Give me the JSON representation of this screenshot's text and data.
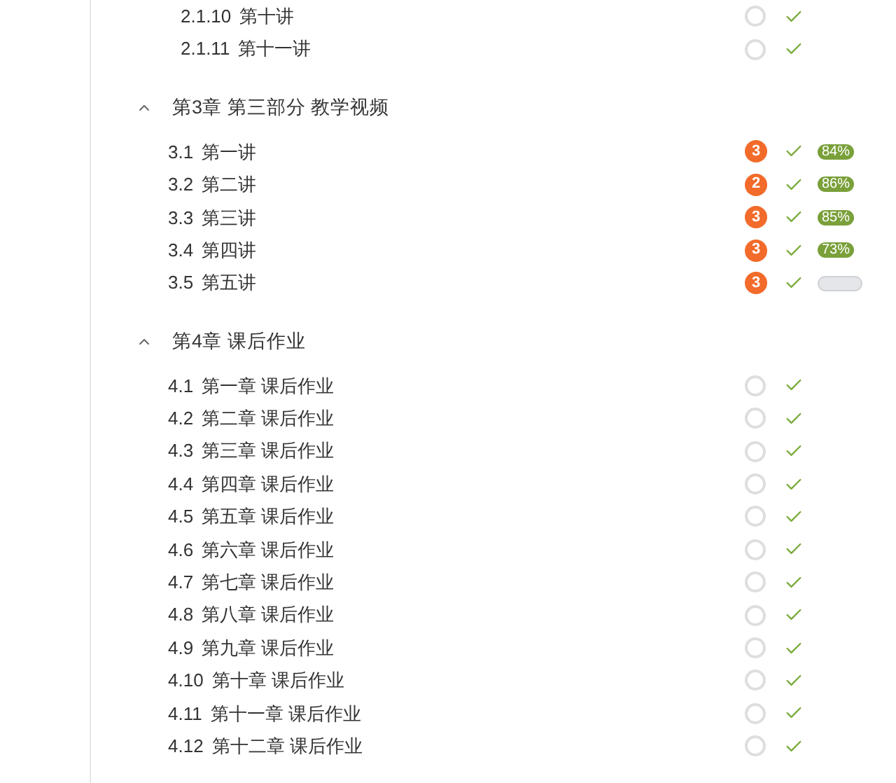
{
  "sections": [
    {
      "items": [
        {
          "number": "2.1.10",
          "title": "第十讲",
          "kind": "ring"
        },
        {
          "number": "2.1.11",
          "title": "第十一讲",
          "kind": "ring"
        }
      ]
    },
    {
      "title": "第3章 第三部分 教学视频",
      "expanded": true,
      "items": [
        {
          "number": "3.1",
          "title": "第一讲",
          "kind": "badge",
          "badge": "3",
          "progress": {
            "kind": "filled",
            "label": "84%"
          }
        },
        {
          "number": "3.2",
          "title": "第二讲",
          "kind": "badge",
          "badge": "2",
          "progress": {
            "kind": "filled",
            "label": "86%"
          }
        },
        {
          "number": "3.3",
          "title": "第三讲",
          "kind": "badge",
          "badge": "3",
          "progress": {
            "kind": "filled",
            "label": "85%"
          }
        },
        {
          "number": "3.4",
          "title": "第四讲",
          "kind": "badge",
          "badge": "3",
          "progress": {
            "kind": "filled",
            "label": "73%"
          }
        },
        {
          "number": "3.5",
          "title": "第五讲",
          "kind": "badge",
          "badge": "3",
          "progress": {
            "kind": "empty"
          }
        }
      ]
    },
    {
      "title": "第4章 课后作业",
      "expanded": true,
      "items": [
        {
          "number": "4.1",
          "title": "第一章 课后作业",
          "kind": "ring"
        },
        {
          "number": "4.2",
          "title": "第二章 课后作业",
          "kind": "ring"
        },
        {
          "number": "4.3",
          "title": "第三章 课后作业",
          "kind": "ring"
        },
        {
          "number": "4.4",
          "title": "第四章 课后作业",
          "kind": "ring"
        },
        {
          "number": "4.5",
          "title": "第五章 课后作业",
          "kind": "ring"
        },
        {
          "number": "4.6",
          "title": "第六章 课后作业",
          "kind": "ring"
        },
        {
          "number": "4.7",
          "title": "第七章 课后作业",
          "kind": "ring"
        },
        {
          "number": "4.8",
          "title": "第八章 课后作业",
          "kind": "ring"
        },
        {
          "number": "4.9",
          "title": "第九章 课后作业",
          "kind": "ring"
        },
        {
          "number": "4.10",
          "title": "第十章 课后作业",
          "kind": "ring"
        },
        {
          "number": "4.11",
          "title": "第十一章 课后作业",
          "kind": "ring"
        },
        {
          "number": "4.12",
          "title": "第十二章 课后作业",
          "kind": "ring"
        }
      ]
    }
  ]
}
